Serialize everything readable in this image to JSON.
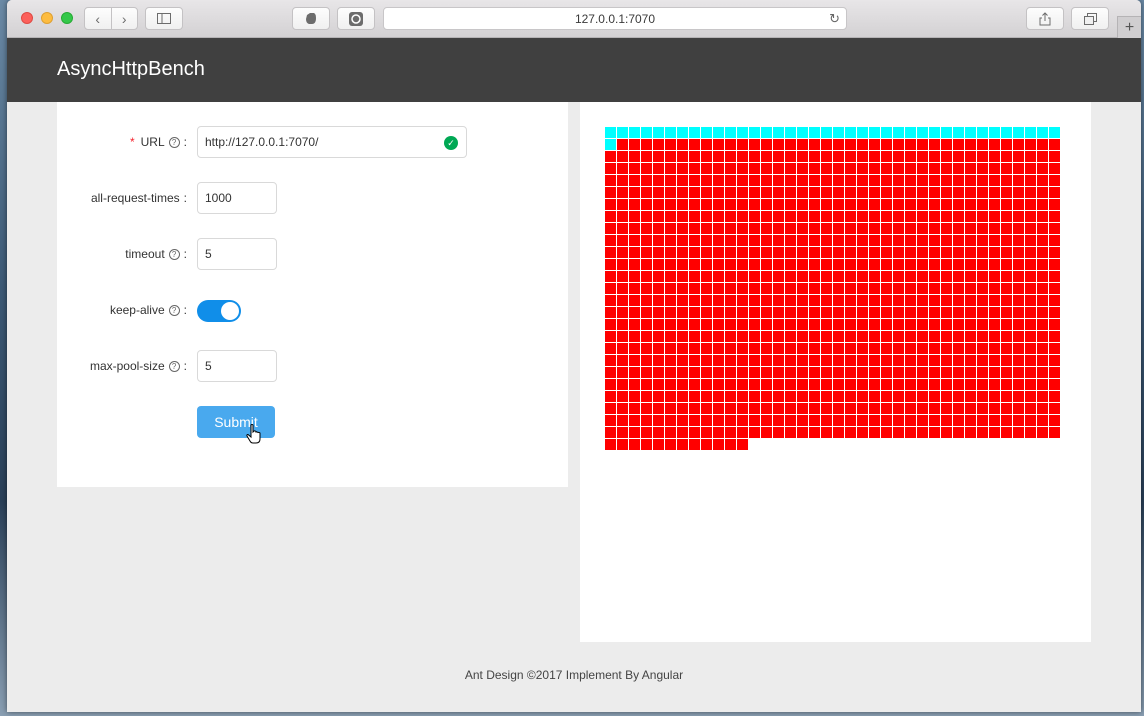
{
  "browser": {
    "url": "127.0.0.1:7070"
  },
  "header": {
    "title": "AsyncHttpBench"
  },
  "form": {
    "url": {
      "label": "URL",
      "value": "http://127.0.0.1:7070/"
    },
    "all_request_times": {
      "label": "all-request-times",
      "value": "1000"
    },
    "timeout": {
      "label": "timeout",
      "value": "5"
    },
    "keep_alive": {
      "label": "keep-alive",
      "on": true
    },
    "max_pool_size": {
      "label": "max-pool-size",
      "value": "5"
    },
    "submit_label": "Submit"
  },
  "colors": {
    "success": "#00ffff",
    "failure": "#ff0000",
    "header_bg": "#404040",
    "switch_on": "#108ee9",
    "button": "#49a9ee"
  },
  "result_grid": {
    "columns": 38,
    "total": 1000,
    "success_count": 39
  },
  "footer": {
    "text": "Ant Design ©2017 Implement By Angular"
  }
}
